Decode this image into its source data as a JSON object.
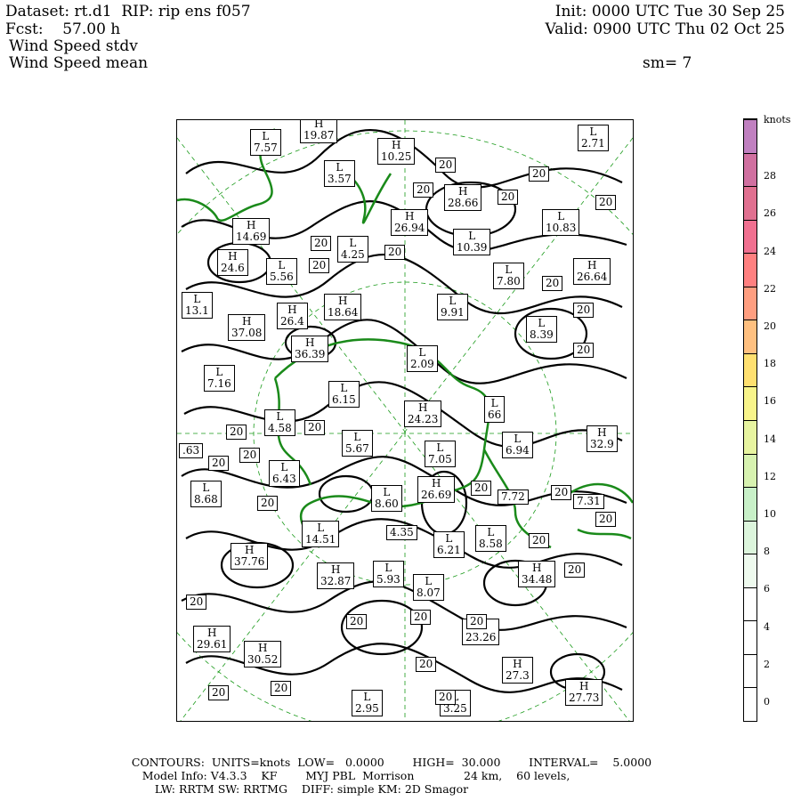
{
  "header": {
    "dataset": "Dataset: rt.d1  RIP: rip ens f057",
    "fcst": "Fcst:    57.00 h",
    "field1": "Wind Speed stdv",
    "field2": "Wind Speed mean",
    "init": "Init: 0000 UTC Tue 30 Sep 25",
    "valid": "Valid: 0900 UTC Thu 02 Oct 25",
    "smooth": "sm= 7"
  },
  "legend": {
    "unit": "knots",
    "ticks": [
      "0",
      "2",
      "4",
      "6",
      "8",
      "10",
      "12",
      "14",
      "16",
      "18",
      "20",
      "22",
      "24",
      "26",
      "28"
    ],
    "colors": [
      "#ffffff",
      "#ffffff",
      "#ffffff",
      "#ffffff",
      "#eefaee",
      "#dcf5dc",
      "#c8f0c8",
      "#d7f2b0",
      "#e7f4a0",
      "#f8f48a",
      "#ffe070",
      "#ffc080",
      "#ff9e80",
      "#ff8080",
      "#f07090",
      "#e07090",
      "#d070a0",
      "#c080c0"
    ]
  },
  "labels": [
    {
      "t": "L",
      "v": "7.57"
    },
    {
      "t": "H",
      "v": "19.87"
    },
    {
      "t": "H",
      "v": "10.25"
    },
    {
      "t": "L",
      "v": "2.71"
    },
    {
      "t": "L",
      "v": "3.57"
    },
    {
      "t": "",
      "v": "20"
    },
    {
      "t": "",
      "v": "20"
    },
    {
      "t": "H",
      "v": "28.66"
    },
    {
      "t": "",
      "v": "20"
    },
    {
      "t": "",
      "v": "20"
    },
    {
      "t": "",
      "v": "20"
    },
    {
      "t": "L",
      "v": "10.83"
    },
    {
      "t": "H",
      "v": "14.69"
    },
    {
      "t": "H",
      "v": "26.94"
    },
    {
      "t": "L",
      "v": "10.39"
    },
    {
      "t": "",
      "v": "20"
    },
    {
      "t": "L",
      "v": "4.25"
    },
    {
      "t": "H",
      "v": "24.6"
    },
    {
      "t": "L",
      "v": "5.56"
    },
    {
      "t": "",
      "v": "20"
    },
    {
      "t": "",
      "v": "20"
    },
    {
      "t": "L",
      "v": "7.80"
    },
    {
      "t": "H",
      "v": "26.64"
    },
    {
      "t": "",
      "v": "20"
    },
    {
      "t": "L",
      "v": "13.1"
    },
    {
      "t": "H",
      "v": "26.4"
    },
    {
      "t": "H",
      "v": "18.64"
    },
    {
      "t": "L",
      "v": "9.91"
    },
    {
      "t": "",
      "v": "20"
    },
    {
      "t": "L",
      "v": "8.39"
    },
    {
      "t": "H",
      "v": "37.08"
    },
    {
      "t": "H",
      "v": "36.39"
    },
    {
      "t": "",
      "v": "20"
    },
    {
      "t": "L",
      "v": "2.09"
    },
    {
      "t": "L",
      "v": "7.16"
    },
    {
      "t": "L",
      "v": "6.15"
    },
    {
      "t": "H",
      "v": "24.23"
    },
    {
      "t": "L",
      "v": "66"
    },
    {
      "t": "L",
      "v": "4.58"
    },
    {
      "t": "",
      "v": "20"
    },
    {
      "t": "",
      "v": "20"
    },
    {
      "t": "L",
      "v": "5.67"
    },
    {
      "t": "L",
      "v": "6.94"
    },
    {
      "t": "H",
      "v": "32.9"
    },
    {
      "t": "",
      "v": ".63"
    },
    {
      "t": "",
      "v": "20"
    },
    {
      "t": "",
      "v": "20"
    },
    {
      "t": "L",
      "v": "7.05"
    },
    {
      "t": "L",
      "v": "6.43"
    },
    {
      "t": "L",
      "v": "8.68"
    },
    {
      "t": "",
      "v": "20"
    },
    {
      "t": "L",
      "v": "8.60"
    },
    {
      "t": "H",
      "v": "26.69"
    },
    {
      "t": "",
      "v": "20"
    },
    {
      "t": "",
      "v": "7.72"
    },
    {
      "t": "",
      "v": "20"
    },
    {
      "t": "",
      "v": "7.31"
    },
    {
      "t": "",
      "v": "20"
    },
    {
      "t": "L",
      "v": "14.51"
    },
    {
      "t": "",
      "v": "4.35"
    },
    {
      "t": "L",
      "v": "6.21"
    },
    {
      "t": "L",
      "v": "8.58"
    },
    {
      "t": "",
      "v": "20"
    },
    {
      "t": "H",
      "v": "37.76"
    },
    {
      "t": "H",
      "v": "32.87"
    },
    {
      "t": "L",
      "v": "5.93"
    },
    {
      "t": "L",
      "v": "8.07"
    },
    {
      "t": "H",
      "v": "34.48"
    },
    {
      "t": "",
      "v": "20"
    },
    {
      "t": "",
      "v": "20"
    },
    {
      "t": "",
      "v": "20"
    },
    {
      "t": "H",
      "v": "23.26"
    },
    {
      "t": "H",
      "v": "29.61"
    },
    {
      "t": "",
      "v": "20"
    },
    {
      "t": "",
      "v": "20"
    },
    {
      "t": "H",
      "v": "27.3"
    },
    {
      "t": "H",
      "v": "30.52"
    },
    {
      "t": "",
      "v": "20"
    },
    {
      "t": "",
      "v": "20"
    },
    {
      "t": "L",
      "v": "3.25"
    },
    {
      "t": "H",
      "v": "27.73"
    },
    {
      "t": "",
      "v": "20"
    },
    {
      "t": "L",
      "v": "2.95"
    },
    {
      "t": "",
      "v": "20"
    }
  ],
  "footer": {
    "line1": "CONTOURS:  UNITS=knots  LOW=   0.0000        HIGH=  30.000        INTERVAL=    5.0000",
    "line2": "Model Info: V4.3.3    KF        MYJ PBL  Morrison              24 km,    60 levels,",
    "line3": "LW: RRTM SW: RRTMG    DIFF: simple KM: 2D Smagor"
  }
}
